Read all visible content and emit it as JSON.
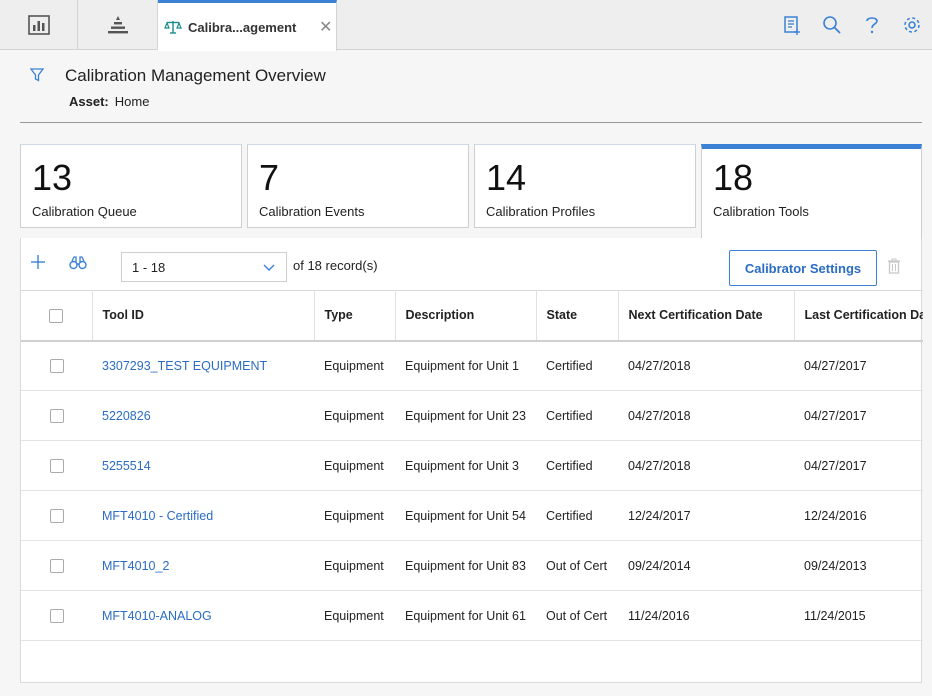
{
  "topbar": {
    "active_tab_label": "Calibra...agement",
    "home_icons": [
      "dashboard-icon",
      "asset-hierarchy-icon"
    ],
    "right_icons": [
      "new-document-icon",
      "search-icon",
      "help-icon",
      "gear-icon"
    ]
  },
  "header": {
    "title": "Calibration Management Overview",
    "asset_label": "Asset:",
    "asset_value": "Home"
  },
  "cards": [
    {
      "count": "13",
      "label": "Calibration Queue"
    },
    {
      "count": "7",
      "label": "Calibration Events"
    },
    {
      "count": "14",
      "label": "Calibration Profiles"
    },
    {
      "count": "18",
      "label": "Calibration Tools"
    }
  ],
  "toolbar": {
    "pager_value": "1 - 18",
    "of_text": "of 18 record(s)",
    "settings_label": "Calibrator Settings"
  },
  "table": {
    "headers": [
      "Tool ID",
      "Type",
      "Description",
      "State",
      "Next Certification Date",
      "Last Certification Da"
    ],
    "rows": [
      {
        "id": "3307293_TEST EQUIPMENT",
        "type": "Equipment",
        "desc": "Equipment for Unit 1",
        "state": "Certified",
        "next": "04/27/2018",
        "last": "04/27/2017"
      },
      {
        "id": "5220826",
        "type": "Equipment",
        "desc": "Equipment for Unit 23",
        "state": "Certified",
        "next": "04/27/2018",
        "last": "04/27/2017"
      },
      {
        "id": "5255514",
        "type": "Equipment",
        "desc": "Equipment for Unit 3",
        "state": "Certified",
        "next": "04/27/2018",
        "last": "04/27/2017"
      },
      {
        "id": "MFT4010 - Certified",
        "type": "Equipment",
        "desc": "Equipment for Unit 54",
        "state": "Certified",
        "next": "12/24/2017",
        "last": "12/24/2016"
      },
      {
        "id": "MFT4010_2",
        "type": "Equipment",
        "desc": "Equipment for Unit 83",
        "state": "Out of Cert",
        "next": "09/24/2014",
        "last": "09/24/2013"
      },
      {
        "id": "MFT4010-ANALOG",
        "type": "Equipment",
        "desc": "Equipment for Unit 61",
        "state": "Out of Cert",
        "next": "11/24/2016",
        "last": "11/24/2015"
      }
    ]
  },
  "colors": {
    "accent": "#3b82d6",
    "link": "#2b6cc4"
  }
}
